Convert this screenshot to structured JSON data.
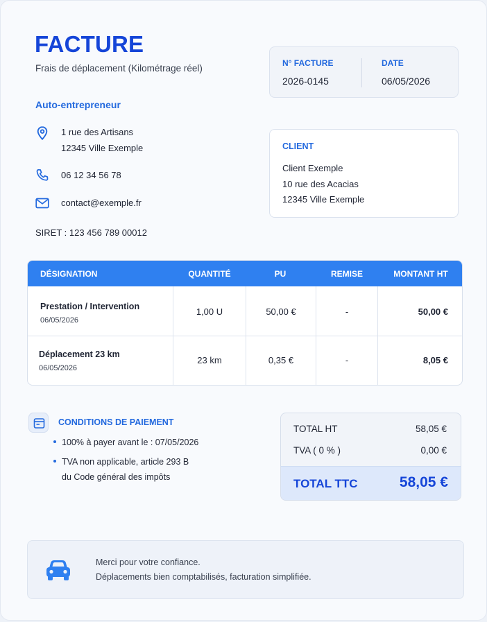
{
  "header": {
    "title": "FACTURE",
    "subtitle": "Frais de déplacement (Kilométrage réel)"
  },
  "issuer": {
    "name": "Auto-entrepreneur",
    "address_line1": "1 rue des Artisans",
    "address_line2": "12345 Ville Exemple",
    "phone": "06 12 34 56 78",
    "email": "contact@exemple.fr",
    "siret": "SIRET : 123 456 789 00012",
    "icons": [
      "location-pin-icon",
      "phone-icon",
      "mail-icon"
    ]
  },
  "meta": {
    "number_label": "N° FACTURE",
    "number_value": "2026-0145",
    "date_label": "DATE",
    "date_value": "06/05/2026"
  },
  "client": {
    "label": "CLIENT",
    "name": "Client Exemple",
    "address_line1": "10 rue des Acacias",
    "address_line2": "12345 Ville Exemple"
  },
  "table": {
    "columns": [
      "DÉSIGNATION",
      "QUANTITÉ",
      "PU",
      "REMISE",
      "MONTANT HT"
    ],
    "rows": [
      {
        "designation": "Prestation / Intervention",
        "date": "06/05/2026",
        "quantity": "1,00 U",
        "unit_price": "50,00 €",
        "discount": "-",
        "amount": "50,00 €"
      },
      {
        "designation": "Déplacement 23 km",
        "date": "06/05/2026",
        "quantity": "23 km",
        "unit_price": "0,35 €",
        "discount": "-",
        "amount": "8,05 €"
      }
    ]
  },
  "conditions": {
    "title": "CONDITIONS DE PAIEMENT",
    "icon": "calendar-card-icon",
    "item1": "100% à payer avant le : 07/05/2026",
    "item2_line1": "TVA non applicable, article 293 B",
    "item2_line2": "du Code général des impôts"
  },
  "totals": {
    "ht_label": "TOTAL HT",
    "ht_value": "58,05 €",
    "tva_label": "TVA ( 0 % )",
    "tva_value": "0,00 €",
    "ttc_label": "TOTAL TTC",
    "ttc_value": "58,05 €"
  },
  "footer": {
    "icon": "car-icon",
    "line1": "Merci pour votre confiance.",
    "line2": "Déplacements bien comptabilisés, facturation simplifiée."
  },
  "colors": {
    "accent": "#1545d8",
    "accent_light": "#2369de",
    "table_header": "#2f80f0"
  }
}
